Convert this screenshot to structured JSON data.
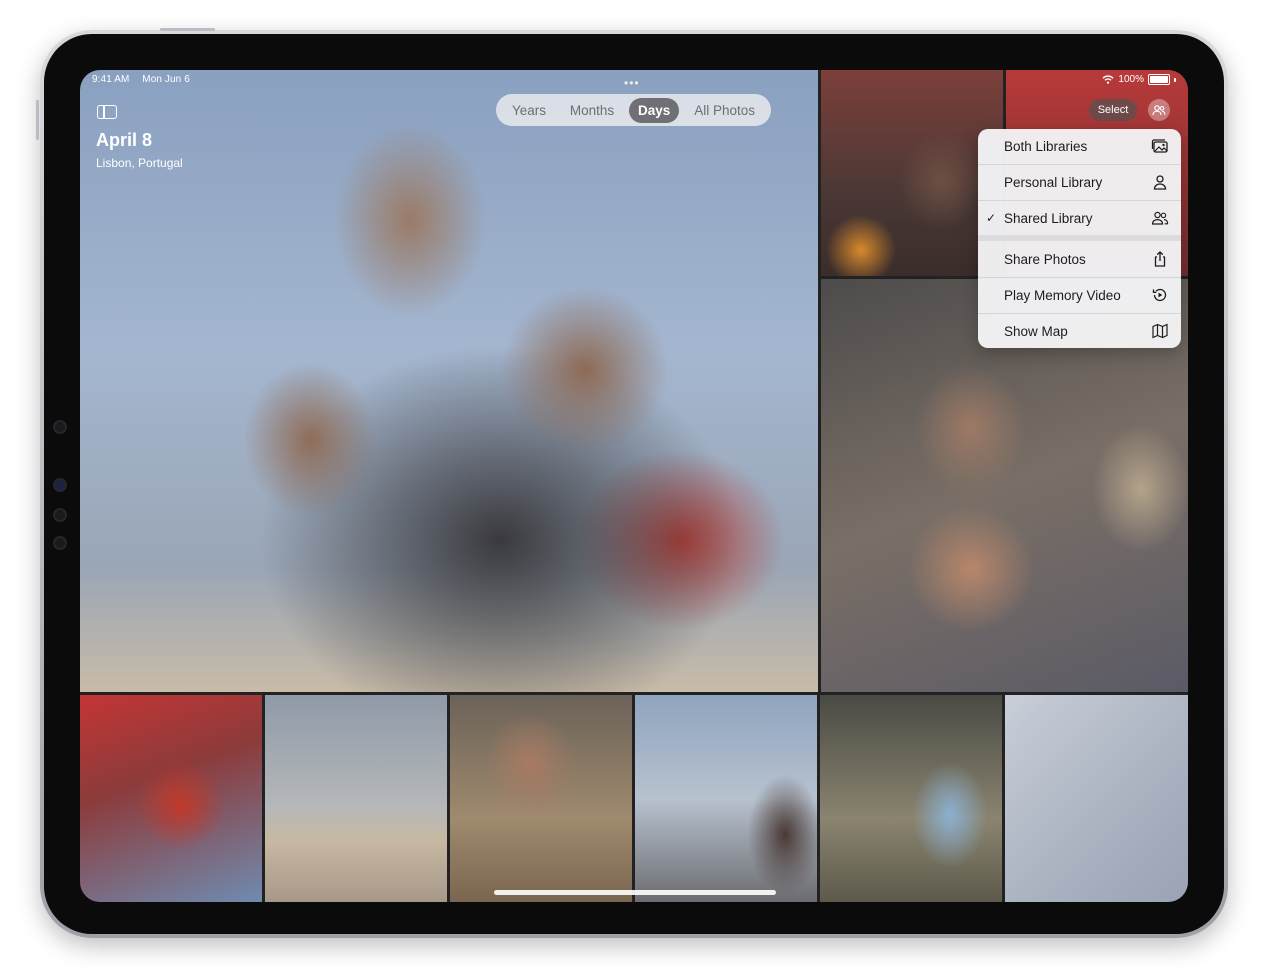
{
  "status_bar": {
    "time": "9:41 AM",
    "date": "Mon Jun 6",
    "battery": "100%"
  },
  "header": {
    "title": "April 8",
    "subtitle": "Lisbon, Portugal"
  },
  "segmented_control": {
    "items": [
      "Years",
      "Months",
      "Days",
      "All Photos"
    ],
    "selected": "Days"
  },
  "toolbar": {
    "select_label": "Select"
  },
  "menu": {
    "items": [
      {
        "label": "Both Libraries",
        "icon": "photos-stack-icon",
        "checked": false
      },
      {
        "label": "Personal Library",
        "icon": "person-icon",
        "checked": false
      },
      {
        "label": "Shared Library",
        "icon": "two-people-icon",
        "checked": true
      },
      {
        "label": "Share Photos",
        "icon": "share-icon",
        "checked": false
      },
      {
        "label": "Play Memory Video",
        "icon": "play-memory-icon",
        "checked": false
      },
      {
        "label": "Show Map",
        "icon": "map-icon",
        "checked": false
      }
    ],
    "check_glyph": "✓"
  }
}
